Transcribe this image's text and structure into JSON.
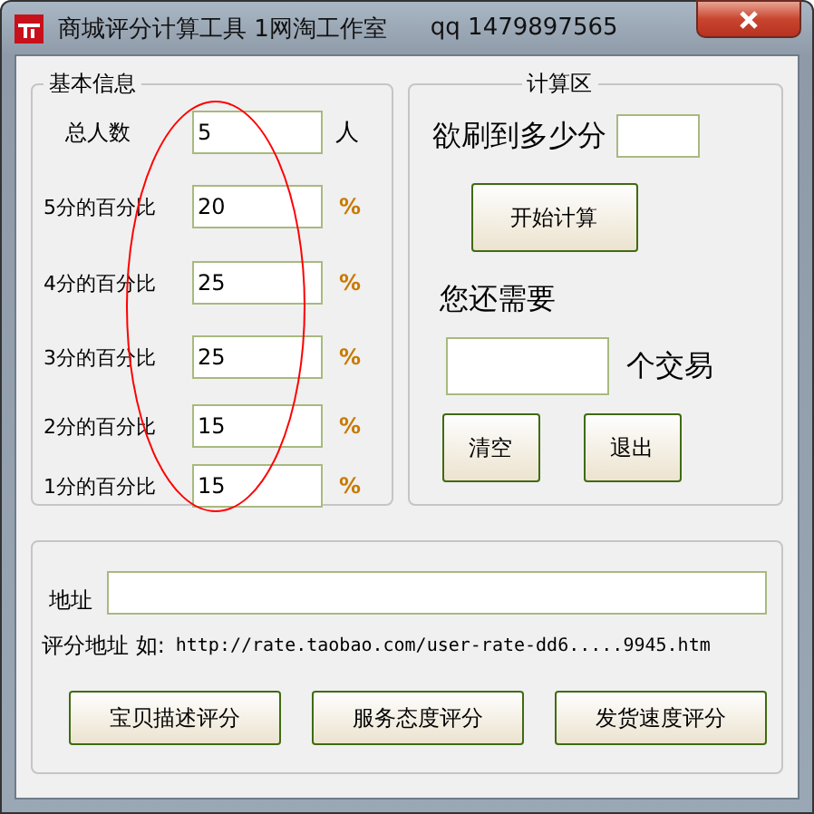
{
  "window": {
    "title": "商城评分计算工具 1网淘工作室",
    "contact": "qq 1479897565"
  },
  "basic_info": {
    "legend": "基本信息",
    "rows": [
      {
        "label": "总人数",
        "value": "5",
        "unit": "人",
        "kind": "count"
      },
      {
        "label": "5分的百分比",
        "value": "20",
        "unit": "%",
        "kind": "percent"
      },
      {
        "label": "4分的百分比",
        "value": "25",
        "unit": "%",
        "kind": "percent"
      },
      {
        "label": "3分的百分比",
        "value": "25",
        "unit": "%",
        "kind": "percent"
      },
      {
        "label": "2分的百分比",
        "value": "15",
        "unit": "%",
        "kind": "percent"
      },
      {
        "label": "1分的百分比",
        "value": "15",
        "unit": "%",
        "kind": "percent"
      }
    ]
  },
  "calc": {
    "legend": "计算区",
    "target_label": "欲刷到多少分",
    "start_button": "开始计算",
    "need_label": "您还需要",
    "need_unit": "个交易",
    "buttons": [
      "清空",
      "退出"
    ]
  },
  "address": {
    "label": "地址",
    "hint_label": "评分地址 如:",
    "hint_url": "http://rate.taobao.com/user-rate-dd6.....9945.htm",
    "buttons": [
      "宝贝描述评分",
      "服务态度评分",
      "发货速度评分"
    ]
  }
}
